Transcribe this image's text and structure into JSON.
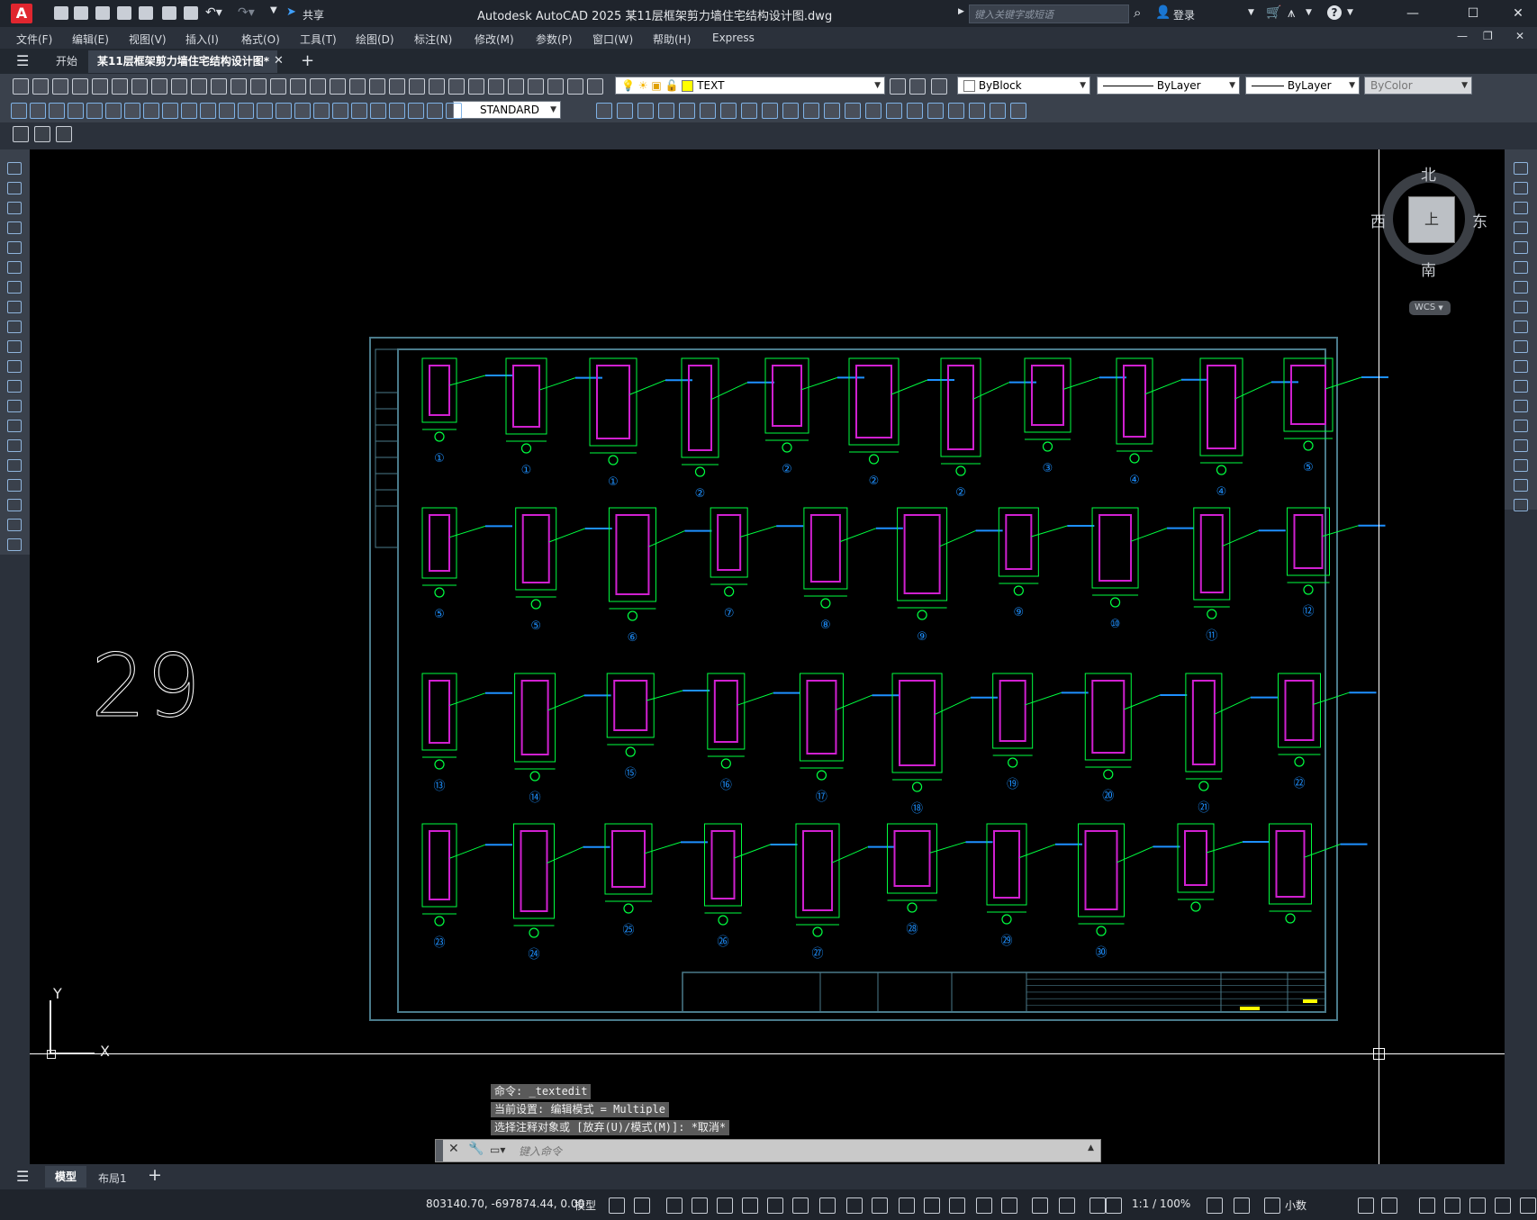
{
  "app": {
    "title": "Autodesk AutoCAD 2025    某11层框架剪力墙住宅结构设计图.dwg",
    "logo": "A",
    "share_label": "共享",
    "search_placeholder": "键入关键字或短语",
    "login_label": "登录"
  },
  "menu": [
    "文件(F)",
    "编辑(E)",
    "视图(V)",
    "插入(I)",
    "格式(O)",
    "工具(T)",
    "绘图(D)",
    "标注(N)",
    "修改(M)",
    "参数(P)",
    "窗口(W)",
    "帮助(H)",
    "Express"
  ],
  "tabs": {
    "start": "开始",
    "document": "某11层框架剪力墙住宅结构设计图*",
    "add": "+"
  },
  "toolbar": {
    "layer_name": "TEXT",
    "color": "ByBlock",
    "linetype": "ByLayer",
    "lineweight": "ByLayer",
    "plotstyle": "ByColor",
    "text_style": "STANDARD"
  },
  "viewcube": {
    "north": "北",
    "south": "南",
    "east": "东",
    "west": "西",
    "top": "上",
    "wcs": "WCS"
  },
  "canvas": {
    "big_number": "29",
    "ucs_x": "X",
    "ucs_y": "Y"
  },
  "detail_labels": [
    "①",
    "①",
    "①",
    "②",
    "②",
    "②",
    "②",
    "③",
    "④",
    "④",
    "⑤",
    "⑤",
    "⑤",
    "⑥",
    "⑦",
    "⑧",
    "⑨",
    "⑨",
    "⑩",
    "⑪",
    "⑫",
    "⑬",
    "⑭",
    "⑮",
    "⑯",
    "⑰",
    "⑱",
    "⑲",
    "⑳",
    "㉑",
    "㉒",
    "㉓",
    "㉔",
    "㉕",
    "㉖",
    "㉗",
    "㉘",
    "㉙",
    "㉚"
  ],
  "command": {
    "history": [
      "命令: _textedit",
      "当前设置: 编辑模式 = Multiple",
      "选择注释对象或 [放弃(U)/模式(M)]: *取消*"
    ],
    "placeholder": "键入命令"
  },
  "layout_tabs": [
    "模型",
    "布局1"
  ],
  "status": {
    "coords": "803140.70, -697874.44, 0.00",
    "model": "模型",
    "scale": "1:1 / 100%",
    "units": "小数"
  },
  "colors": {
    "frame": "#4a7a8a",
    "steel": "#00ff40",
    "rebar": "#d020d0",
    "label": "#1e90ff"
  }
}
